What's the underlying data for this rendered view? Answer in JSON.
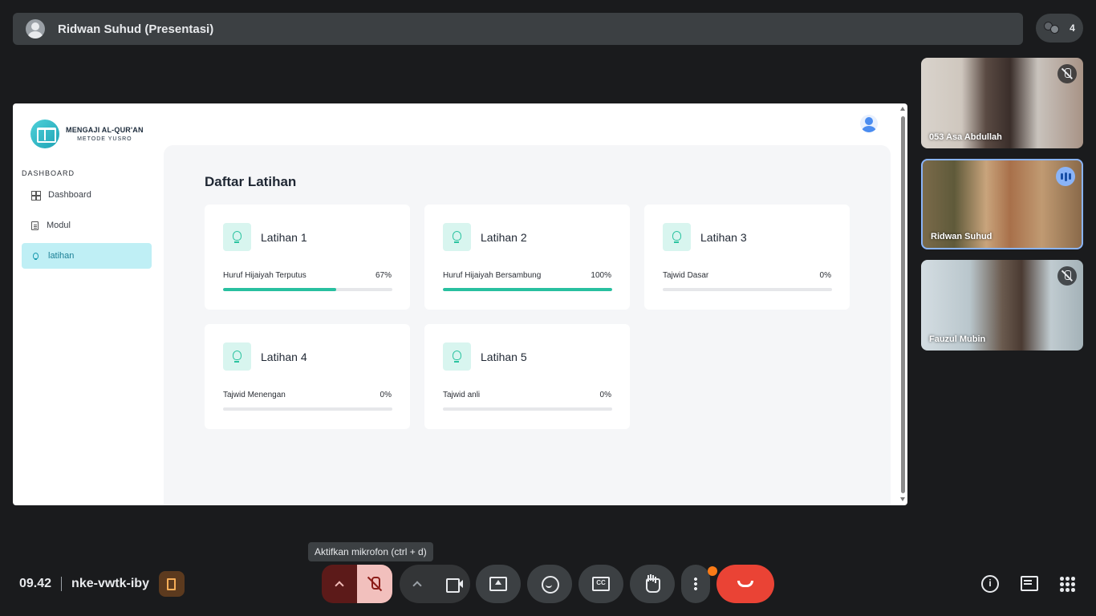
{
  "meet": {
    "presenter_title": "Ridwan Suhud (Presentasi)",
    "people_count": "4",
    "participants": [
      {
        "name": "053 Asa Abdullah",
        "mic": "muted"
      },
      {
        "name": "Ridwan Suhud",
        "mic": "speaking"
      },
      {
        "name": "Fauzul Mubin",
        "mic": "muted"
      }
    ],
    "time": "09.42",
    "meeting_code": "nke-vwtk-iby",
    "tooltip": "Aktifkan mikrofon (ctrl + d)",
    "colors": {
      "end_call": "#ea4335",
      "mic_off": "#f2c0bd",
      "notification": "#fa7b17"
    }
  },
  "app": {
    "logo_line1": "MENGAJI AL-QUR'AN",
    "logo_line2": "METODE YUSRO",
    "sidebar_heading": "DASHBOARD",
    "nav": [
      {
        "label": "Dashboard",
        "icon": "grid-icon",
        "active": false
      },
      {
        "label": "Modul",
        "icon": "document-icon",
        "active": false
      },
      {
        "label": "latihan",
        "icon": "lightbulb-icon",
        "active": true
      }
    ],
    "page_title": "Daftar Latihan",
    "accent": "#28c0a0",
    "cards": [
      {
        "title": "Latihan 1",
        "subtitle": "Huruf Hijaiyah Terputus",
        "percent": "67%",
        "progress": 0.67
      },
      {
        "title": "Latihan 2",
        "subtitle": "Huruf Hijaiyah Bersambung",
        "percent": "100%",
        "progress": 1.0
      },
      {
        "title": "Latihan 3",
        "subtitle": "Tajwid Dasar",
        "percent": "0%",
        "progress": 0
      },
      {
        "title": "Latihan 4",
        "subtitle": "Tajwid Menengan",
        "percent": "0%",
        "progress": 0
      },
      {
        "title": "Latihan 5",
        "subtitle": "Tajwid anli",
        "percent": "0%",
        "progress": 0
      }
    ]
  }
}
